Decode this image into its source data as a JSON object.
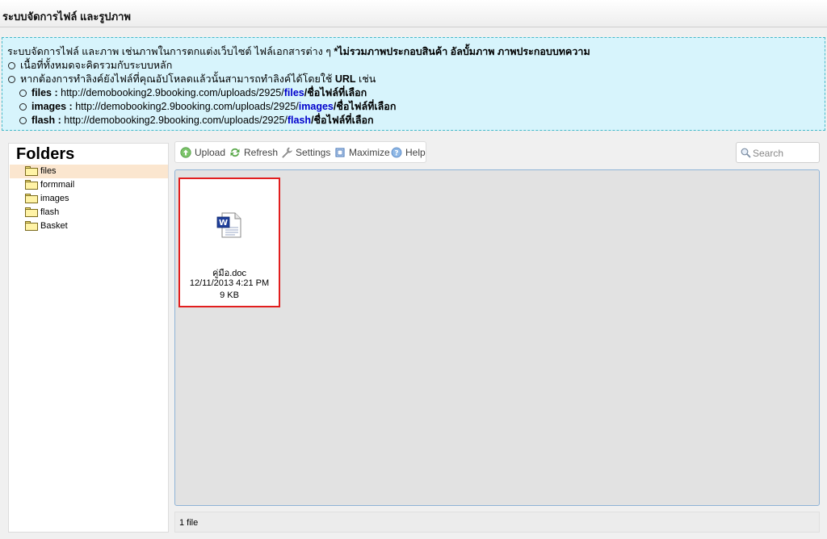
{
  "header": {
    "title": "ระบบจัดการไฟล์ และรูปภาพ"
  },
  "info": {
    "intro_plain": "ระบบจัดการไฟล์ และภาพ เช่นภาพในการตกแต่งเว็บไซต์ ไฟล์เอกสารต่าง ๆ ",
    "intro_bold": "*ไม่รวมภาพประกอบสินค้า อัลบั้มภาพ ภาพประกอบบทความ",
    "bullet1": "เนื้อที่ทั้งหมดจะคิดรวมกับระบบหลัก",
    "bullet2_plain": "หากต้องการทำลิงค์ยังไฟล์ที่คุณอัปโหลดแล้วนั้นสามารถทำลิงค์ได้โดยใช้ ",
    "bullet2_bold": "URL",
    "bullet2_tail": " เช่น",
    "examples": [
      {
        "label": "files :",
        "url": " http://demobooking2.9booking.com/uploads/2925/",
        "folder": "files",
        "suffix": "/ชื่อไฟล์ที่เลือก"
      },
      {
        "label": "images :",
        "url": " http://demobooking2.9booking.com/uploads/2925/",
        "folder": "images",
        "suffix": "/ชื่อไฟล์ที่เลือก"
      },
      {
        "label": "flash :",
        "url": " http://demobooking2.9booking.com/uploads/2925/",
        "folder": "flash",
        "suffix": "/ชื่อไฟล์ที่เลือก"
      }
    ]
  },
  "folders": {
    "title": "Folders",
    "items": [
      {
        "label": "files",
        "selected": true
      },
      {
        "label": "formmail",
        "selected": false
      },
      {
        "label": "images",
        "selected": false
      },
      {
        "label": "flash",
        "selected": false
      },
      {
        "label": "Basket",
        "selected": false
      }
    ]
  },
  "toolbar": {
    "upload": "Upload",
    "refresh": "Refresh",
    "settings": "Settings",
    "maximize": "Maximize",
    "help": "Help"
  },
  "search": {
    "placeholder": "Search"
  },
  "files": [
    {
      "name": "คู่มือ.doc",
      "date": "12/11/2013 4:21 PM",
      "size": "9 KB",
      "icon": "word-document-icon"
    }
  ],
  "status": {
    "text": "1 file"
  },
  "colors": {
    "accent_blue": "#0000cc",
    "selected_folder": "#fbe6cf",
    "info_bg": "#d7f4fc",
    "highlight_border": "#e21e1e"
  }
}
